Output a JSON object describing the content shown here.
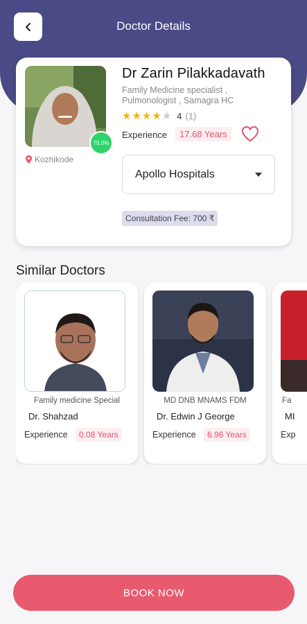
{
  "header": {
    "title": "Doctor Details"
  },
  "doctor": {
    "name": "Dr Zarin Pilakkadavath",
    "specialization": "Family Medicine specialist  , Pulmonologist , Samagra HC",
    "rating_value": "4",
    "rating_count": "(1)",
    "stars": 4,
    "profile_percent": "75.0%",
    "location": "Kozhikode",
    "experience_label": "Experience",
    "experience_value": "17.68 Years",
    "hospital_selected": "Apollo Hospitals",
    "consultation_fee": "Consultation Fee: 700 ₹"
  },
  "similar": {
    "title": "Similar Doctors",
    "doctors": [
      {
        "specialization": "Family medicine Special",
        "name": "Dr. Shahzad",
        "experience_label": "Experience",
        "experience_value": "0.08 Years"
      },
      {
        "specialization": "MD DNB MNAMS FDM",
        "name": "Dr. Edwin J George",
        "experience_label": "Experience",
        "experience_value": "6.96 Years"
      },
      {
        "specialization": "Fa",
        "name": "MI",
        "experience_label": "Exp",
        "experience_value": ""
      }
    ]
  },
  "actions": {
    "book_label": "BOOK NOW"
  },
  "colors": {
    "header": "#4a4a86",
    "accent": "#e85b6e",
    "badge_text": "#e0566c",
    "rating_green": "#2fd36b",
    "star": "#f5b301"
  }
}
